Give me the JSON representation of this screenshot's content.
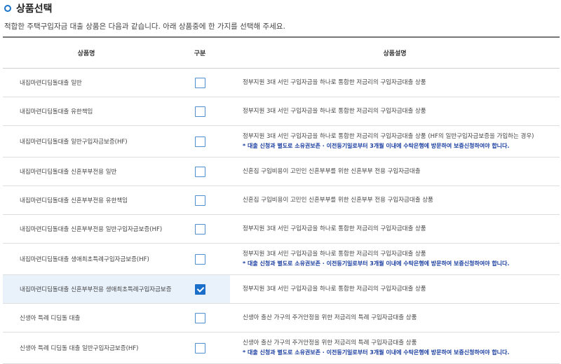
{
  "header": {
    "title": "상품선택",
    "intro": "적합한 주택구입자금 대출 상품은 다음과 같습니다. 아래 상품중에 한 가지를 선택해 주세요."
  },
  "table": {
    "columns": [
      "상품명",
      "구분",
      "상품설명"
    ],
    "rows": [
      {
        "name": "내집마련디딤돌대출 일반",
        "checked": false,
        "desc": "정부지원 3대 서민 구입자금을 하나로 통합한 저금리의 구입자금대출 상품",
        "note": ""
      },
      {
        "name": "내집마련디딤돌대출 유한책임",
        "checked": false,
        "desc": "정부지원 3대 서민 구입자금을 하나로 통합한 저금리의 구입자금대출 상품",
        "note": ""
      },
      {
        "name": "내집마련디딤돌대출 일반구입자금보증(HF)",
        "checked": false,
        "desc": "정부지원 3대 서민 구입자금을 하나로 통합한 저금리의 구입자금대출 상품 (HF의 일반구입자금보증을 가입하는 경우)",
        "note": "* 대출 신청과 별도로 소유권보존 · 이전등기일로부터 3개월 이내에 수탁은행에 방문하여 보증신청하여야 합니다."
      },
      {
        "name": "내집마련디딤돌대출 신혼부부전용 일반",
        "checked": false,
        "desc": "신혼집 구입비용이 고민인 신혼부부를 위한 신혼부부 전용 구입자금대출",
        "note": ""
      },
      {
        "name": "내집마련디딤돌대출 신혼부부전용 유한책임",
        "checked": false,
        "desc": "신혼집 구입비용이 고민인 신혼부부를 위한 신혼부부 전용 구입자금대출 상품",
        "note": ""
      },
      {
        "name": "내집마련디딤돌대출 신혼부부전용 일반구입자금보증(HF)",
        "checked": false,
        "desc": "정부지원 3대 서민 구입자금을 하나로 통합한 저금리의 구입자금대출 상품",
        "note": ""
      },
      {
        "name": "내집마련디딤돌대출 생애최초특례구입자금보증(HF)",
        "checked": false,
        "desc": "정부지원 3대 서민 구입자금을 하나로 통합한 저금리의 구입자금대출 상품",
        "note": "* 대출 신청과 별도로 소유권보존 · 이전등기일로부터 3개월 이내에 수탁은행에 방문하여 보증신청하여야 합니다."
      },
      {
        "name": "내집마련디딤돌대출 신혼부부전용 생애최초특례구입자금보증",
        "checked": true,
        "desc": "정부지원 3대 서민 구입자금을 하나로 통합한 저금리의 구입자금대출 상품",
        "note": ""
      },
      {
        "name": "신생아 특례 디딤돌 대출",
        "checked": false,
        "desc": "신생아 출산 가구의 주거안정을 위한 저금리의 특례 구입자금대출 상품",
        "note": ""
      },
      {
        "name": "신생아 특례 디딤돌 대출 일반구입자금보증(HF)",
        "checked": false,
        "desc": "신생아 출산 가구의 주거안정을 위한 저금리의 특례 구입자금대출 상품",
        "note": "* 대출 신청과 별도로 소유권보존 · 이전등기일로부터 3개월 이내에 수탁은행에 방문하여 보증신청하여야 합니다."
      }
    ]
  },
  "colors": {
    "accent": "#1b6fc9",
    "note": "#1b3fa0",
    "selected_bg": "#e9f1fb"
  }
}
